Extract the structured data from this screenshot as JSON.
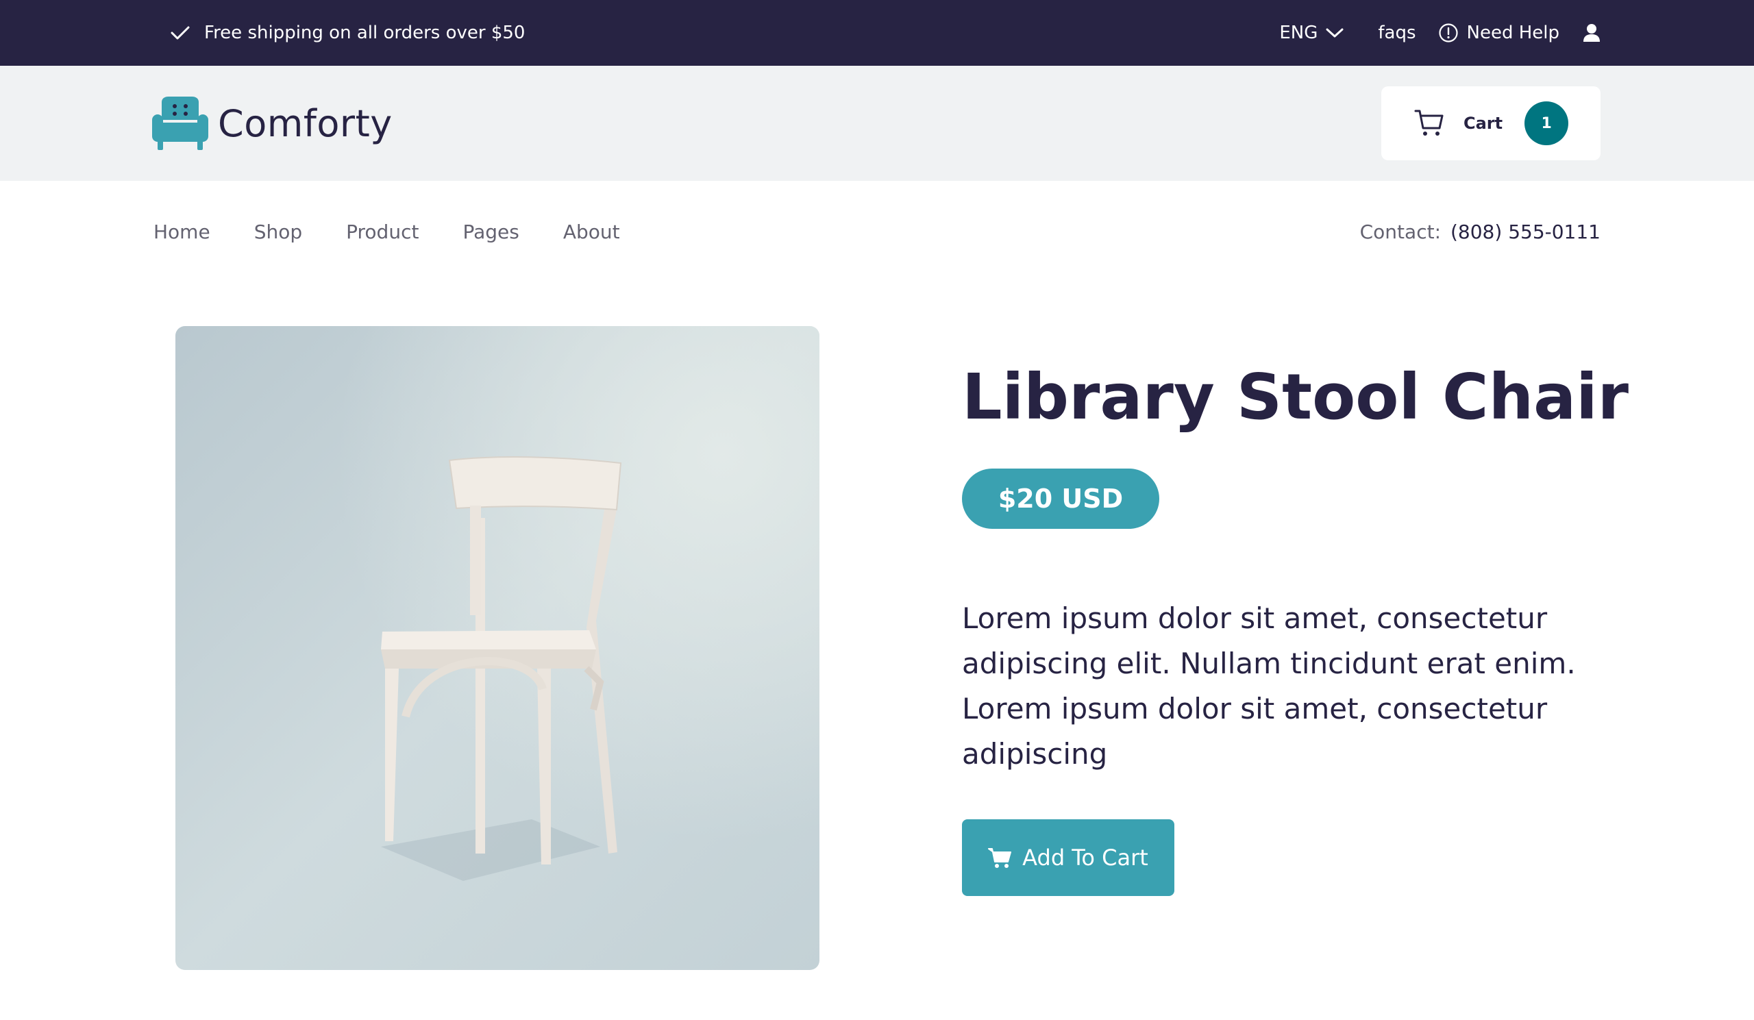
{
  "topbar": {
    "shipping_text": "Free shipping on all orders over $50",
    "language": "ENG",
    "faqs": "faqs",
    "help": "Need Help"
  },
  "header": {
    "brand": "Comforty",
    "cart_label": "Cart",
    "cart_count": "1"
  },
  "nav": {
    "items": [
      "Home",
      "Shop",
      "Product",
      "Pages",
      "About"
    ],
    "contact_label": "Contact:",
    "contact_phone": "(808) 555-0111"
  },
  "product": {
    "title": "Library Stool Chair",
    "price": "$20 USD",
    "description": "Lorem ipsum dolor sit amet, consectetur adipiscing elit. Nullam tincidunt erat enim. Lorem ipsum dolor sit amet, consectetur adipiscing",
    "add_to_cart": "Add To Cart"
  },
  "colors": {
    "dark": "#272343",
    "accent": "#3aa1b1",
    "badge": "#007580",
    "header_bg": "#f0f2f3"
  },
  "icons": {
    "check": "check-icon",
    "chevron": "chevron-down-icon",
    "help": "info-circle-icon",
    "user": "user-icon",
    "logo": "armchair-icon",
    "cart": "cart-icon",
    "add_to_cart": "cart-solid-icon"
  }
}
